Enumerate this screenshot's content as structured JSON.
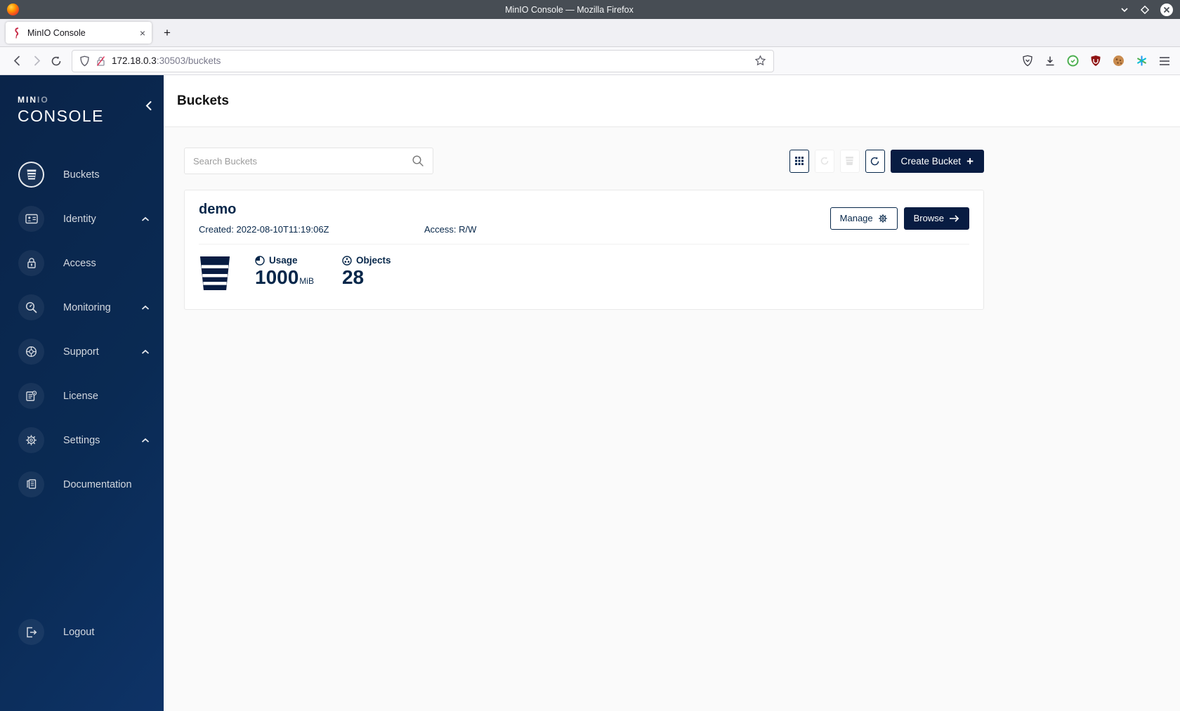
{
  "window": {
    "title": "MinIO Console — Mozilla Firefox"
  },
  "browser": {
    "tab": {
      "title": "MinIO Console",
      "close_glyph": "×"
    },
    "new_tab_glyph": "+",
    "url": {
      "host": "172.18.0.3",
      "rest": ":30503/buckets"
    }
  },
  "sidebar": {
    "logo": {
      "part1": "MIN",
      "part2": "IO",
      "line2": "CONSOLE"
    },
    "items": [
      {
        "label": "Buckets",
        "icon": "bucket-icon",
        "active": true,
        "expandable": false
      },
      {
        "label": "Identity",
        "icon": "identity-card-icon",
        "active": false,
        "expandable": true
      },
      {
        "label": "Access",
        "icon": "lock-icon",
        "active": false,
        "expandable": false
      },
      {
        "label": "Monitoring",
        "icon": "monitor-magnifier-icon",
        "active": false,
        "expandable": true
      },
      {
        "label": "Support",
        "icon": "lifebuoy-icon",
        "active": false,
        "expandable": true
      },
      {
        "label": "License",
        "icon": "license-document-icon",
        "active": false,
        "expandable": false
      },
      {
        "label": "Settings",
        "icon": "gear-icon",
        "active": false,
        "expandable": true
      },
      {
        "label": "Documentation",
        "icon": "documentation-book-icon",
        "active": false,
        "expandable": false
      }
    ],
    "logout": {
      "label": "Logout",
      "icon": "logout-icon"
    }
  },
  "page": {
    "title": "Buckets",
    "search": {
      "placeholder": "Search Buckets"
    },
    "actions": {
      "create_label": "Create Bucket",
      "create_plus_glyph": "+"
    },
    "bucket": {
      "name": "demo",
      "created": "Created: 2022-08-10T11:19:06Z",
      "access": "Access: R/W",
      "manage_label": "Manage",
      "browse_label": "Browse",
      "usage_label": "Usage",
      "usage_value": "1000",
      "usage_unit": "MiB",
      "objects_label": "Objects",
      "objects_value": "28"
    }
  },
  "colors": {
    "navy": "#081C42",
    "text_navy": "#07274A",
    "titlebar": "#474D54",
    "ublock_red": "#8f1313",
    "green_badge": "#4caf50"
  }
}
